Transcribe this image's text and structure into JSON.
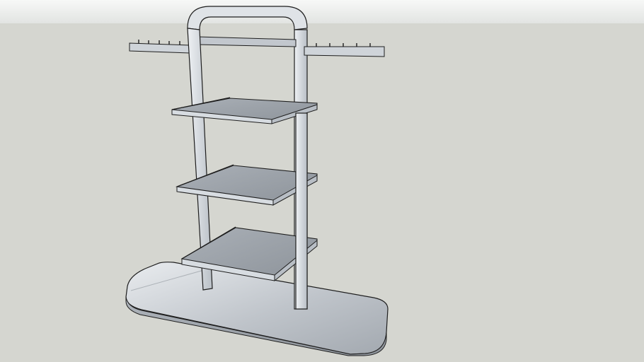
{
  "scene": {
    "model": "display-rack-3-shelves",
    "sky_color_top": "#f7f8f7",
    "sky_color_bottom": "#e2e4e2",
    "ground_color": "#d5d6d0",
    "edge_color": "#1e1e1e",
    "metal_light": "#e1e5e9",
    "metal_mid": "#b7bdc4",
    "metal_dark": "#8f959c",
    "shelf_top_color": "#9ea4ab",
    "shelf_count": 3,
    "hook_count_left": 5,
    "hook_count_right": 5
  }
}
